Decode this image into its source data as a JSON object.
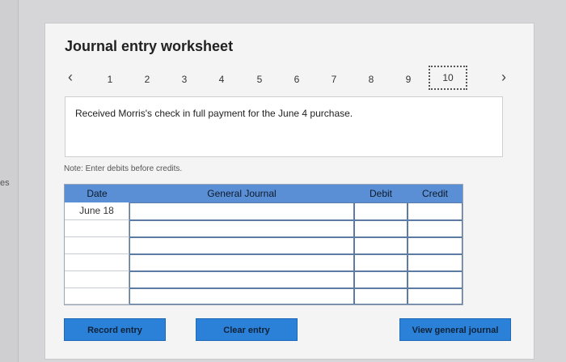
{
  "side_label": "es",
  "title": "Journal entry worksheet",
  "pagination": {
    "prev_icon": "‹",
    "next_icon": "›",
    "pages": [
      "1",
      "2",
      "3",
      "4",
      "5",
      "6",
      "7",
      "8",
      "9"
    ],
    "active": "10"
  },
  "description": "Received Morris's check in full payment for the June 4 purchase.",
  "note": "Note: Enter debits before credits.",
  "table": {
    "headers": {
      "date": "Date",
      "account": "General Journal",
      "debit": "Debit",
      "credit": "Credit"
    },
    "rows": [
      {
        "date": "June 18",
        "account": "",
        "debit": "",
        "credit": ""
      },
      {
        "date": "",
        "account": "",
        "debit": "",
        "credit": ""
      },
      {
        "date": "",
        "account": "",
        "debit": "",
        "credit": ""
      },
      {
        "date": "",
        "account": "",
        "debit": "",
        "credit": ""
      },
      {
        "date": "",
        "account": "",
        "debit": "",
        "credit": ""
      },
      {
        "date": "",
        "account": "",
        "debit": "",
        "credit": ""
      }
    ]
  },
  "buttons": {
    "record": "Record entry",
    "clear": "Clear entry",
    "view": "View general journal"
  },
  "colors": {
    "header": "#5a8fd6",
    "button": "#2b80d8"
  }
}
